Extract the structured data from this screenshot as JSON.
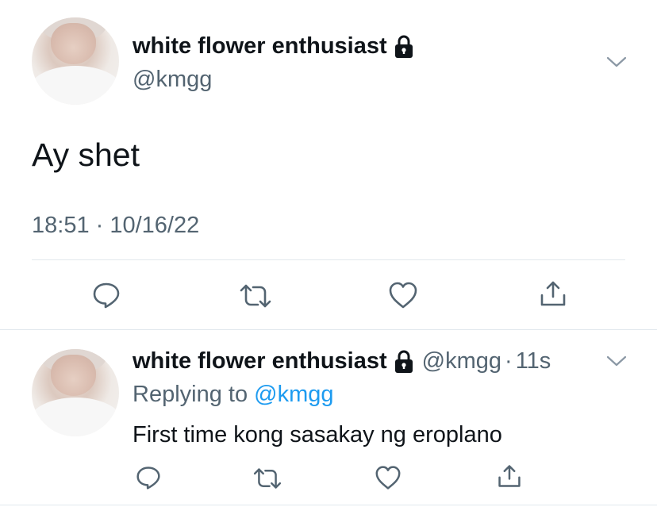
{
  "main_tweet": {
    "author_name": "white flower enthusiast",
    "author_handle": "@kmgg",
    "text": "Ay shet",
    "timestamp": "18:51 · 10/16/22"
  },
  "reply_tweet": {
    "author_name": "white flower enthusiast",
    "author_handle": "@kmgg",
    "separator": "·",
    "time_ago": "11s",
    "replying_prefix": "Replying to",
    "replying_handle": "@kmgg",
    "text": "First time kong sasakay ng eroplano"
  },
  "colors": {
    "text": "#0f1419",
    "secondary": "#536471",
    "link": "#1d9bf0",
    "divider": "#e1e8ed"
  },
  "icons": [
    "lock-icon",
    "chevron-down-icon",
    "reply-icon",
    "retweet-icon",
    "like-icon",
    "share-icon"
  ]
}
